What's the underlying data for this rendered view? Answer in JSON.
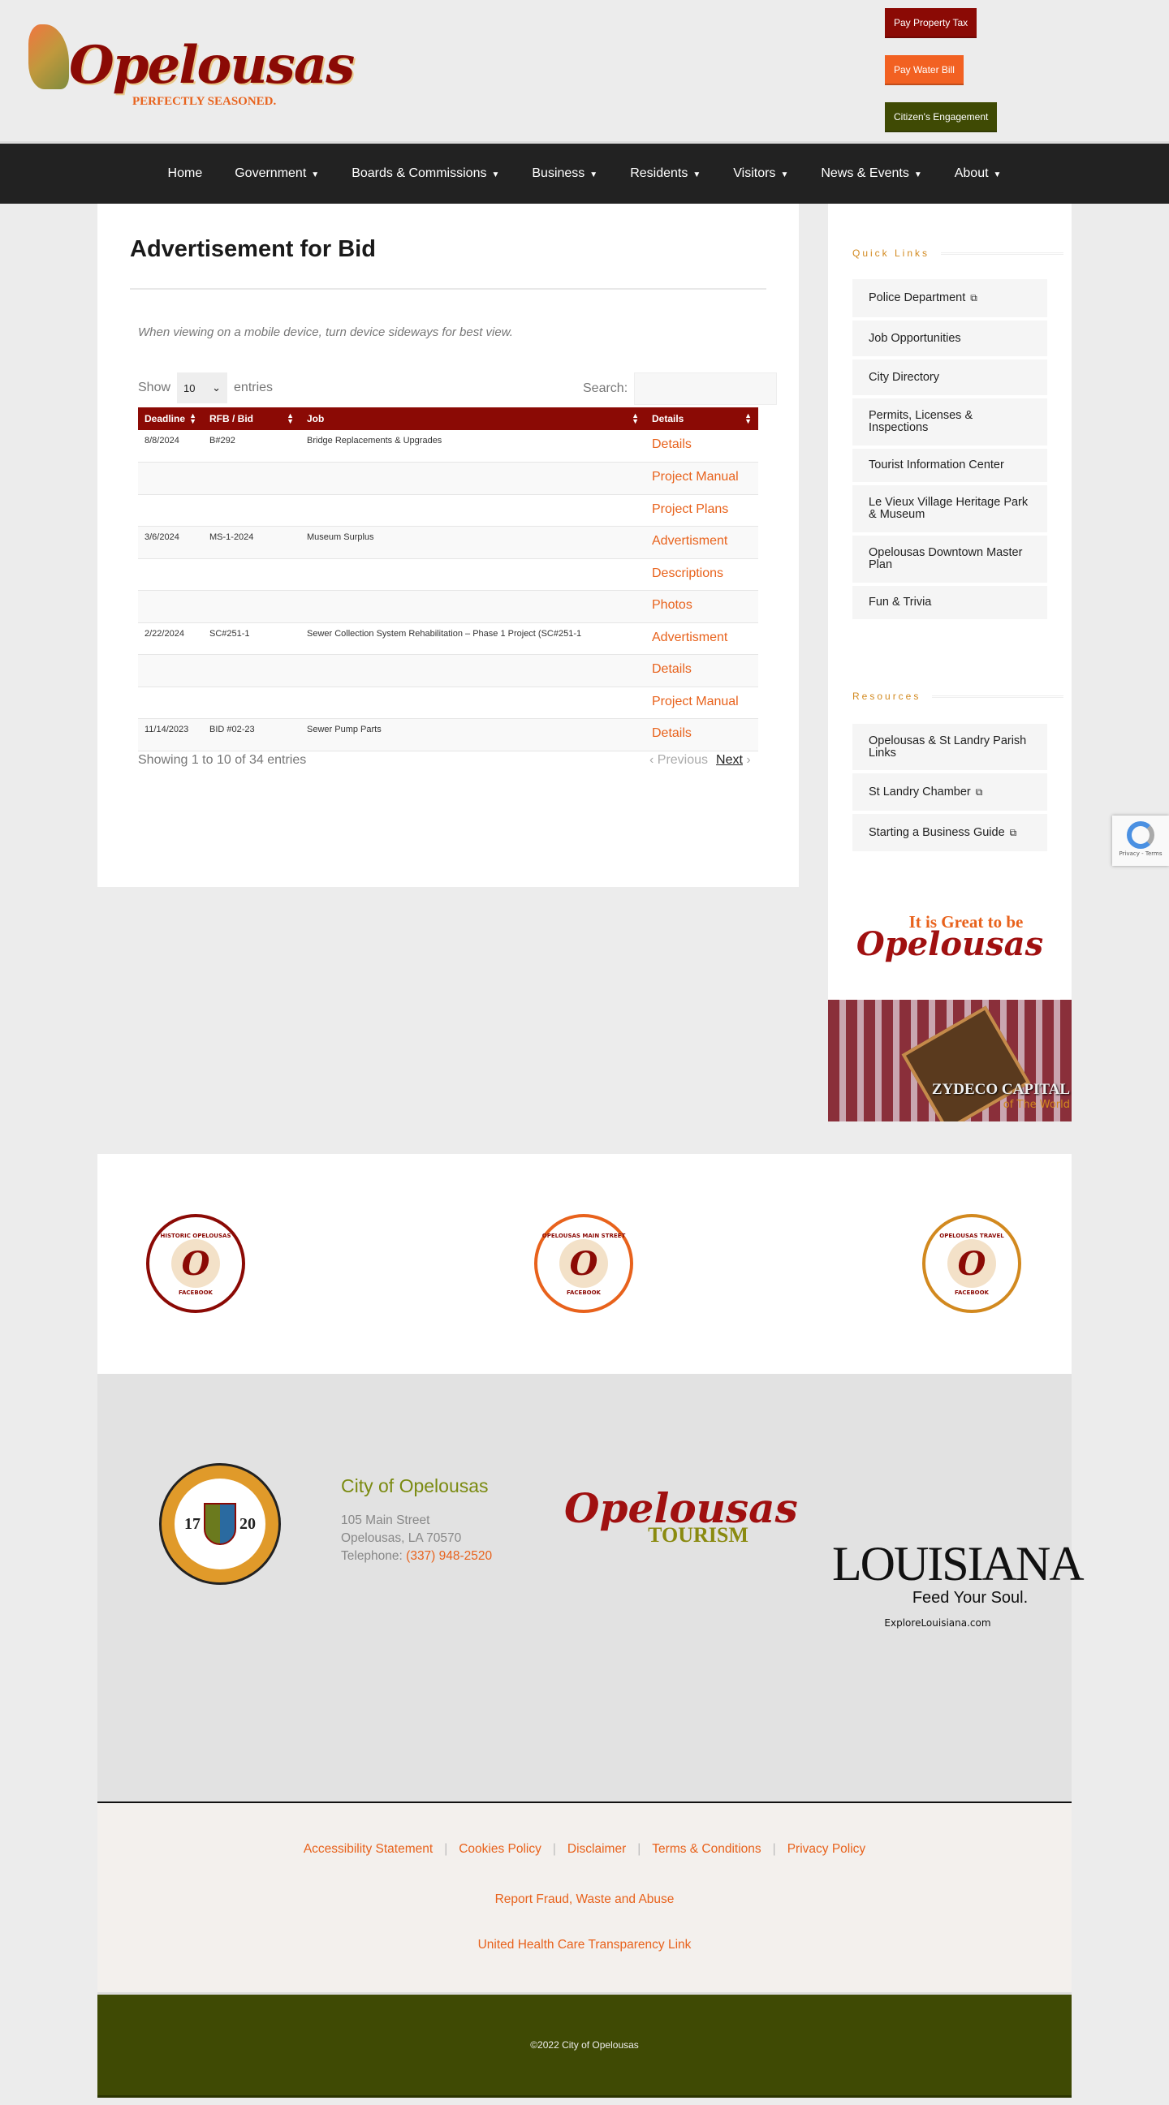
{
  "header": {
    "logo_text": "Opelousas",
    "logo_tagline": "PERFECTLY SEASONED.",
    "buttons": [
      {
        "label": "Pay Property Tax",
        "color": "#8b0a05"
      },
      {
        "label": "Pay Water Bill",
        "color": "#f26122"
      },
      {
        "label": "Citizen's Engagement",
        "color": "#3f4a04"
      }
    ]
  },
  "nav": {
    "items": [
      {
        "label": "Home"
      },
      {
        "label": "Government",
        "dropdown": true
      },
      {
        "label": "Boards & Commissions",
        "dropdown": true
      },
      {
        "label": "Business",
        "dropdown": true
      },
      {
        "label": "Residents",
        "dropdown": true
      },
      {
        "label": "Visitors",
        "dropdown": true
      },
      {
        "label": "News & Events",
        "dropdown": true
      },
      {
        "label": "About",
        "dropdown": true
      }
    ],
    "caret": "▼"
  },
  "main": {
    "title": "Advertisement for Bid",
    "note": "When viewing on a mobile device, turn device sideways for best view.",
    "show_label": "Show",
    "entries_value": "10",
    "entries_label": "entries",
    "search_label": "Search:",
    "search_value": "",
    "columns": [
      "Deadline",
      "RFB / Bid",
      "Job",
      "Details"
    ],
    "rows": [
      [
        "8/8/2024",
        "B#292",
        "Bridge Replacements & Upgrades",
        "Details"
      ],
      [
        "",
        "",
        "",
        "Project Manual"
      ],
      [
        "",
        "",
        "",
        "Project Plans"
      ],
      [
        "3/6/2024",
        "MS-1-2024",
        "Museum Surplus",
        "Advertisment"
      ],
      [
        "",
        "",
        "",
        "Descriptions"
      ],
      [
        "",
        "",
        "",
        "Photos"
      ],
      [
        "2/22/2024",
        "SC#251-1",
        "Sewer Collection System Rehabilitation – Phase 1 Project (SC#251-1",
        "Advertisment"
      ],
      [
        "",
        "",
        "",
        "Details"
      ],
      [
        "",
        "",
        "",
        "Project Manual"
      ],
      [
        "11/14/2023",
        "BID #02-23",
        "Sewer Pump Parts",
        "Details"
      ]
    ],
    "info": "Showing 1 to 10 of 34 entries",
    "prev": "Previous",
    "next": "Next"
  },
  "sidebar": {
    "quick_links_title": "Quick Links",
    "quick_links": [
      {
        "label": "Police Department",
        "external": true
      },
      {
        "label": "Job Opportunities"
      },
      {
        "label": "City Directory"
      },
      {
        "label": "Permits, Licenses & Inspections"
      },
      {
        "label": "Tourist Information Center"
      },
      {
        "label": "Le Vieux Village Heritage Park & Museum"
      },
      {
        "label": "Opelousas Downtown Master Plan"
      },
      {
        "label": "Fun & Trivia"
      }
    ],
    "resources_title": "Resources",
    "resources": [
      {
        "label": "Opelousas & St Landry Parish Links"
      },
      {
        "label": "St Landry Chamber",
        "external": true
      },
      {
        "label": "Starting a Business Guide",
        "external": true
      }
    ],
    "promo_text": "It is Great to be",
    "promo_logo": "Opelousas",
    "zydeco_title": "ZYDECO CAPITAL",
    "zydeco_sub": "of The World"
  },
  "social": [
    {
      "name": "HISTORIC OPELOUSAS",
      "sub": "FACEBOOK"
    },
    {
      "name": "OPELOUSAS MAIN STREET",
      "sub": "FACEBOOK"
    },
    {
      "name": "OPELOUSAS TRAVEL",
      "sub": "FACEBOOK"
    }
  ],
  "footer": {
    "seal_left": "17",
    "seal_right": "20",
    "city_title": "City of Opelousas",
    "address1": "105 Main Street",
    "address2": "Opelousas, LA 70570",
    "phone_label": "Telephone:",
    "phone": "(337) 948-2520",
    "tourism_logo": "Opelousas",
    "tourism_sub": "TOURISM",
    "la_logo": "LOUISIANA",
    "la_tagline": "Feed Your Soul.",
    "la_url": "ExploreLouisiana.com"
  },
  "legal": {
    "links": [
      "Accessibility Statement",
      "Cookies Policy",
      "Disclaimer",
      "Terms & Conditions",
      "Privacy Policy"
    ],
    "fraud": "Report Fraud, Waste and Abuse",
    "uhc": "United Health Care Transparency Link"
  },
  "copyright": "©2022 City of Opelousas",
  "recaptcha": "Privacy - Terms"
}
